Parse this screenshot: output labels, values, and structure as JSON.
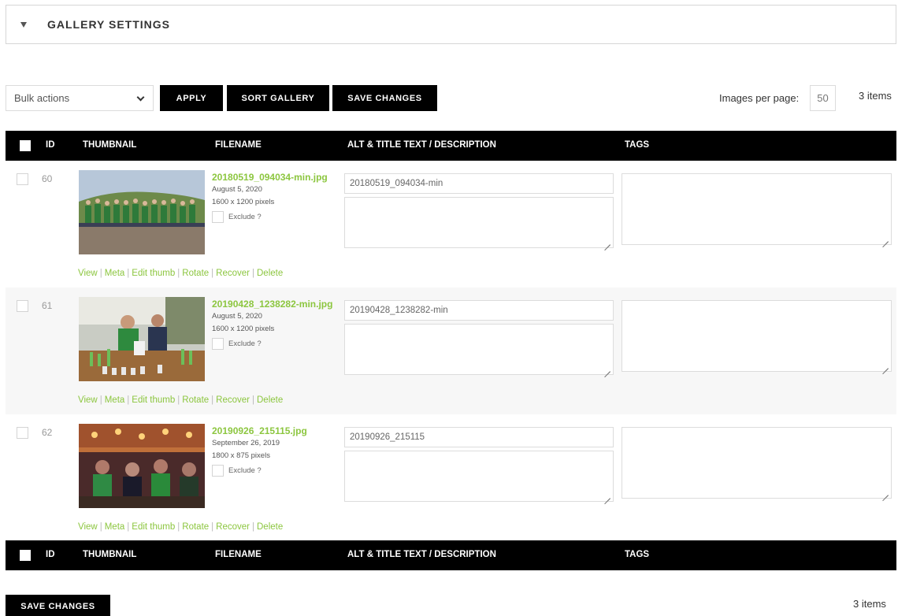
{
  "settings": {
    "title": "GALLERY SETTINGS"
  },
  "toolbar": {
    "bulk_actions": "Bulk actions",
    "apply": "APPLY",
    "sort_gallery": "SORT GALLERY",
    "save_changes": "SAVE CHANGES",
    "images_per_page_label": "Images per page:",
    "images_per_page_value": "50",
    "items_count": "3 items"
  },
  "table": {
    "columns": [
      "ID",
      "THUMBNAIL",
      "FILENAME",
      "ALT & TITLE TEXT / DESCRIPTION",
      "TAGS"
    ],
    "rows": [
      {
        "id": "60",
        "filename": "20180519_094034-min.jpg",
        "date": "August 5, 2020",
        "size": "1600 x 1200 pixels",
        "exclude_label": "Exclude ?",
        "alt_title": "20180519_094034-min",
        "actions": [
          "View",
          "Meta",
          "Edit thumb",
          "Rotate",
          "Recover",
          "Delete"
        ]
      },
      {
        "id": "61",
        "filename": "20190428_1238282-min.jpg",
        "date": "August 5, 2020",
        "size": "1600 x 1200 pixels",
        "exclude_label": "Exclude ?",
        "alt_title": "20190428_1238282-min",
        "actions": [
          "View",
          "Meta",
          "Edit thumb",
          "Rotate",
          "Recover",
          "Delete"
        ]
      },
      {
        "id": "62",
        "filename": "20190926_215115.jpg",
        "date": "September 26, 2019",
        "size": "1800 x 875 pixels",
        "exclude_label": "Exclude ?",
        "alt_title": "20190926_215115",
        "actions": [
          "View",
          "Meta",
          "Edit thumb",
          "Rotate",
          "Recover",
          "Delete"
        ]
      }
    ]
  },
  "footer": {
    "save_changes": "SAVE CHANGES",
    "items_count": "3 items"
  },
  "colors": {
    "accent": "#8cc63f",
    "header_bg": "#000000"
  }
}
